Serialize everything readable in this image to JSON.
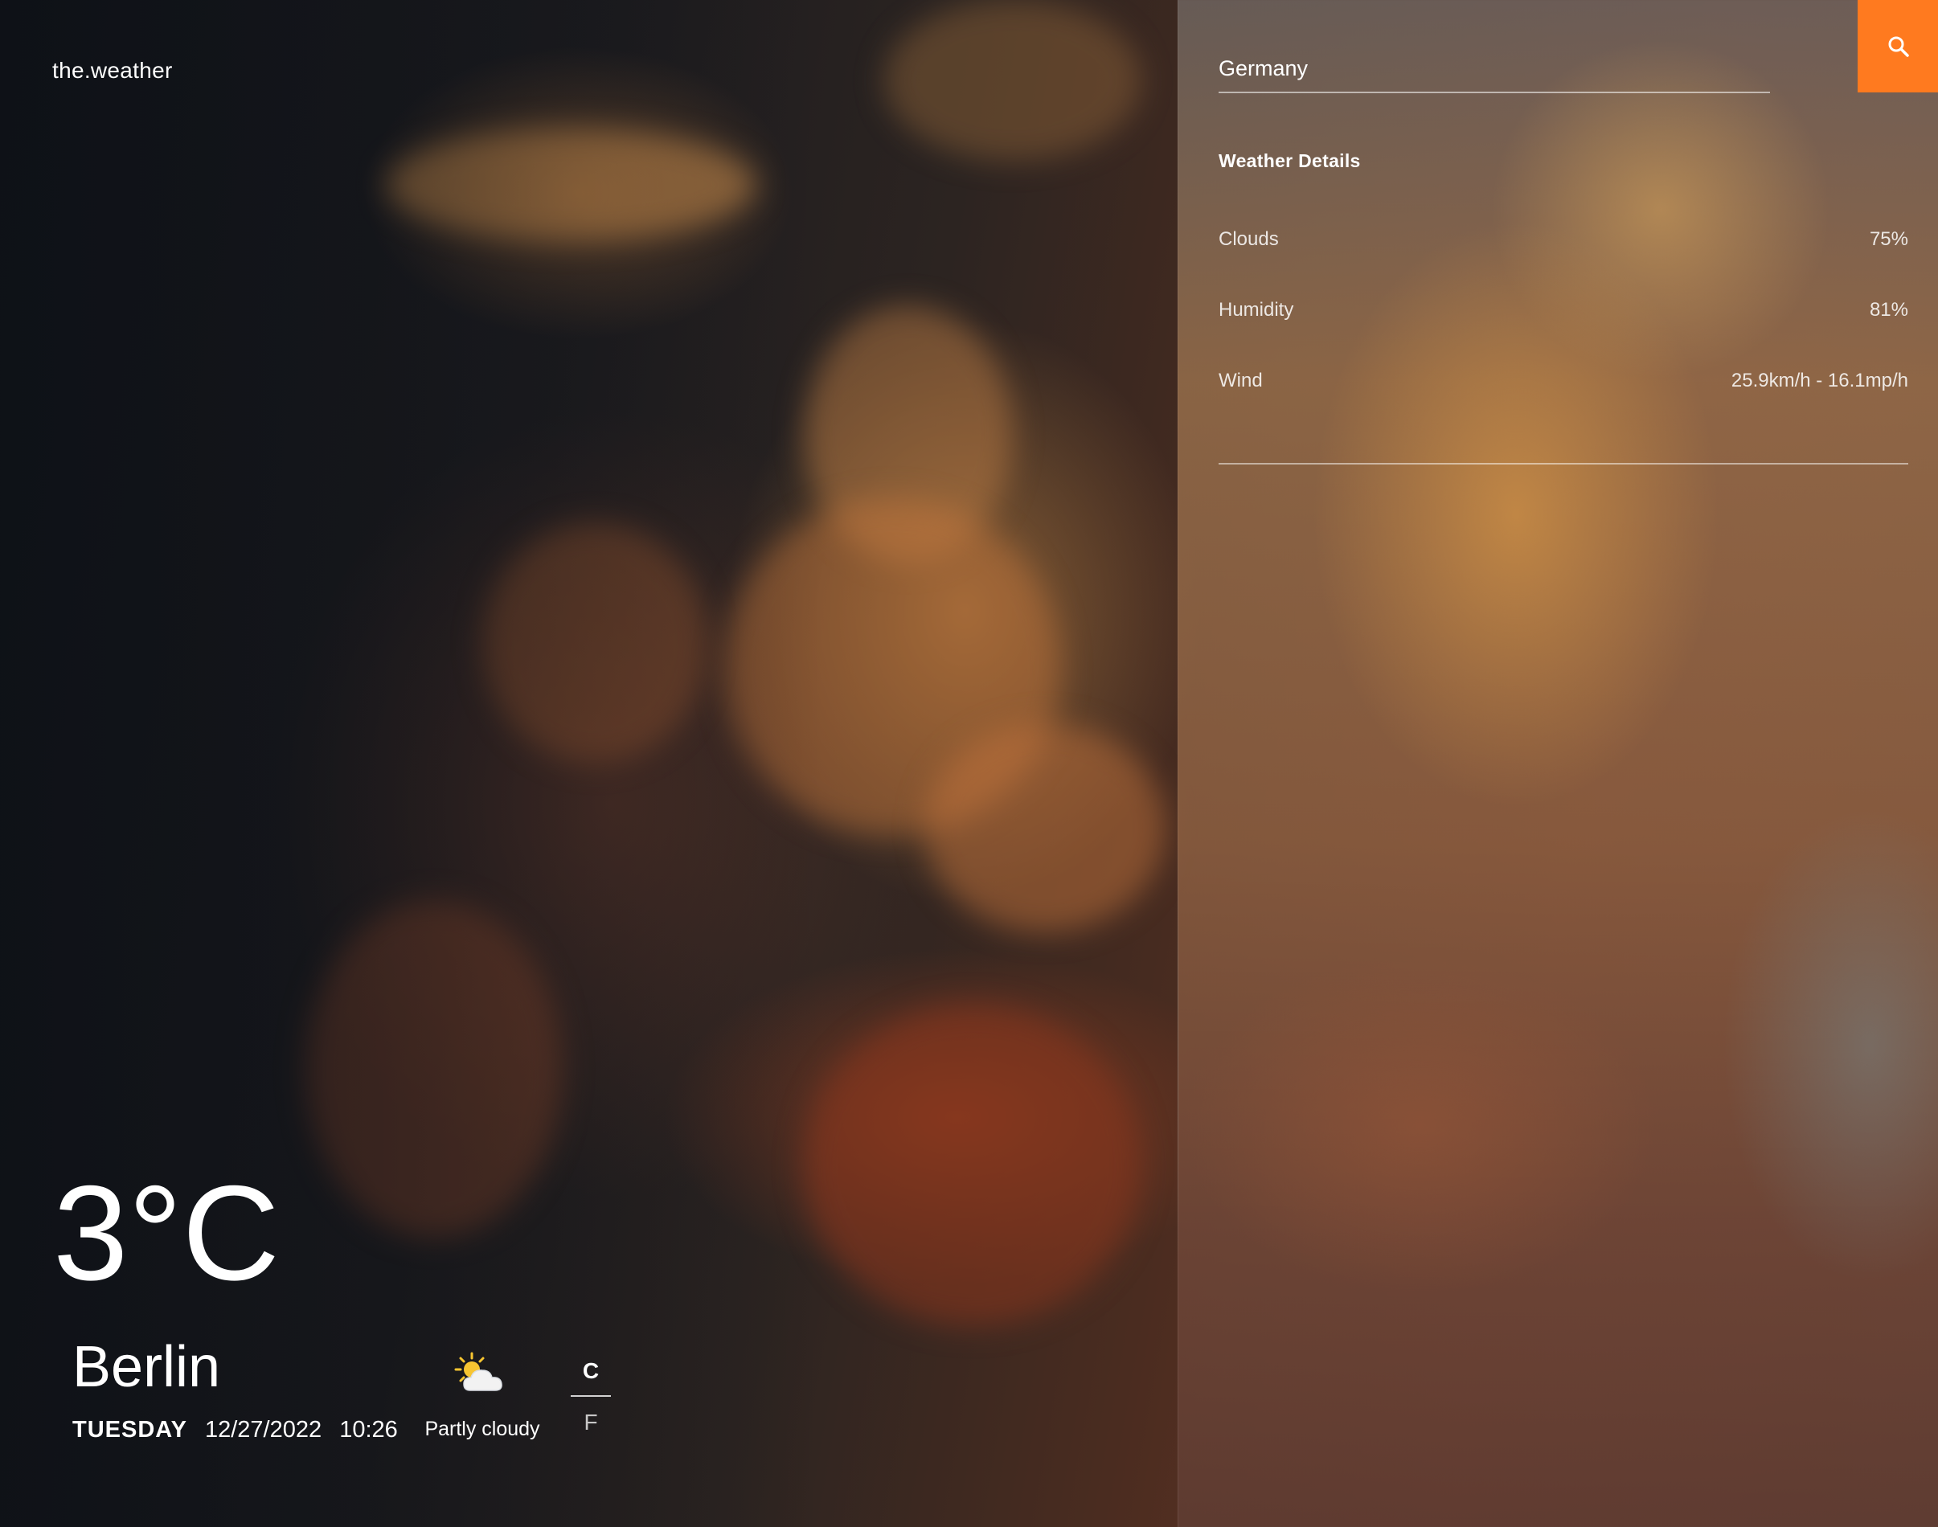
{
  "app": {
    "brand": "the.weather"
  },
  "current": {
    "temperature": "3°C",
    "city": "Berlin",
    "day": "TUESDAY",
    "date": "12/27/2022",
    "time": "10:26",
    "condition": "Partly cloudy",
    "condition_icon": "partly-cloudy-icon"
  },
  "units": {
    "celsius": "C",
    "fahrenheit": "F",
    "selected": "C"
  },
  "search": {
    "value": "Germany",
    "button_icon": "search-icon"
  },
  "details": {
    "title": "Weather Details",
    "items": [
      {
        "label": "Clouds",
        "value": "75%"
      },
      {
        "label": "Humidity",
        "value": "81%"
      },
      {
        "label": "Wind",
        "value": "25.9km/h - 16.1mp/h"
      }
    ]
  },
  "colors": {
    "accent": "#ff7a1f",
    "text": "#ffffff"
  }
}
